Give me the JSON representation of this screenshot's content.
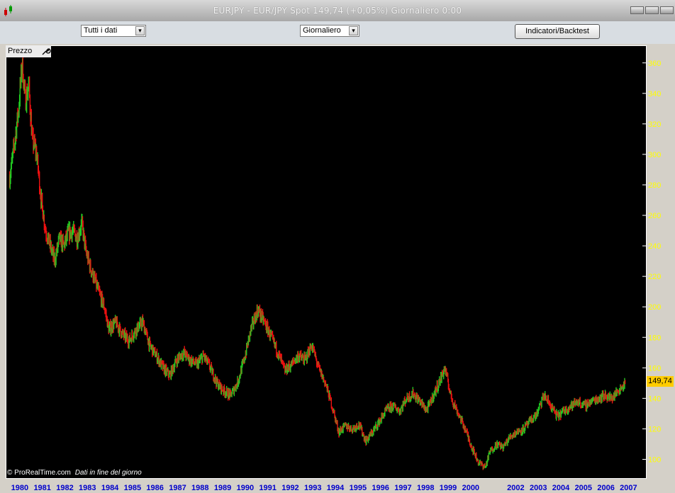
{
  "window": {
    "title": "EURJPY - EUR/JPY Spot    149,74 (+0,05%)    Giornaliero  0:00"
  },
  "toolbar": {
    "period_select": "Tutti i dati",
    "interval_select": "Giornaliero",
    "indicators_button": "Indicatori/Backtest"
  },
  "panel": {
    "label": "Prezzo",
    "last_price_tag": "149,74",
    "copyright": "© ProRealTime.com",
    "data_note": "Dati in fine del giorno"
  },
  "colors": {
    "background": "#000000",
    "up_candle": "#22cc22",
    "down_candle": "#ee1111",
    "y_axis_text": "#ffff00",
    "x_axis_text": "#0000cc",
    "price_tag": "#ffcc00"
  },
  "chart_data": {
    "type": "line",
    "title": "EURJPY",
    "xlabel": "",
    "ylabel": "",
    "ylim": [
      90,
      365
    ],
    "y_ticks": [
      100,
      120,
      140,
      160,
      180,
      200,
      220,
      240,
      260,
      280,
      300,
      320,
      340,
      360
    ],
    "x_ticks": [
      "1980",
      "1981",
      "1982",
      "1983",
      "1984",
      "1985",
      "1986",
      "1987",
      "1988",
      "1989",
      "1990",
      "1991",
      "1992",
      "1993",
      "1994",
      "1995",
      "1996",
      "1997",
      "1998",
      "1999",
      "2000",
      "2002",
      "2003",
      "2004",
      "2005",
      "2006",
      "2007"
    ],
    "x": [
      1979.6,
      1979.8,
      1980.0,
      1980.15,
      1980.3,
      1980.45,
      1980.6,
      1980.8,
      1981.0,
      1981.2,
      1981.4,
      1981.6,
      1981.8,
      1982.0,
      1982.2,
      1982.4,
      1982.6,
      1982.8,
      1983.0,
      1983.2,
      1983.5,
      1983.8,
      1984.0,
      1984.3,
      1984.6,
      1984.9,
      1985.2,
      1985.5,
      1985.8,
      1986.1,
      1986.4,
      1986.7,
      1987.0,
      1987.3,
      1987.6,
      1987.9,
      1988.2,
      1988.5,
      1988.8,
      1989.1,
      1989.4,
      1989.7,
      1990.0,
      1990.3,
      1990.6,
      1990.9,
      1991.2,
      1991.5,
      1991.8,
      1992.1,
      1992.4,
      1992.7,
      1993.0,
      1993.3,
      1993.6,
      1993.9,
      1994.2,
      1994.5,
      1994.8,
      1995.1,
      1995.4,
      1995.7,
      1996.0,
      1996.3,
      1996.6,
      1996.9,
      1997.2,
      1997.5,
      1997.8,
      1998.1,
      1998.4,
      1998.7,
      1998.9,
      1999.2,
      1999.5,
      1999.8,
      2000.1,
      2000.4,
      2000.7,
      2000.9,
      2001.2,
      2001.5,
      2001.8,
      2002.1,
      2002.4,
      2002.7,
      2003.0,
      2003.3,
      2003.6,
      2003.9,
      2004.2,
      2004.5,
      2004.8,
      2005.1,
      2005.4,
      2005.7,
      2006.0,
      2006.3,
      2006.6,
      2006.9
    ],
    "series": [
      {
        "values": [
          285,
          305,
          330,
          360,
          335,
          345,
          310,
          300,
          270,
          250,
          240,
          230,
          245,
          240,
          248,
          250,
          245,
          255,
          235,
          225,
          212,
          200,
          185,
          190,
          182,
          178,
          185,
          190,
          175,
          168,
          160,
          155,
          165,
          170,
          165,
          162,
          168,
          160,
          150,
          145,
          142,
          150,
          165,
          185,
          198,
          190,
          180,
          170,
          158,
          162,
          168,
          165,
          175,
          160,
          150,
          135,
          118,
          122,
          120,
          123,
          112,
          118,
          125,
          132,
          135,
          132,
          140,
          143,
          138,
          132,
          142,
          152,
          160,
          140,
          130,
          120,
          108,
          98,
          95,
          105,
          110,
          108,
          115,
          118,
          120,
          125,
          130,
          142,
          135,
          128,
          132,
          135,
          138,
          135,
          138,
          140,
          142,
          140,
          145,
          150
        ]
      }
    ]
  }
}
